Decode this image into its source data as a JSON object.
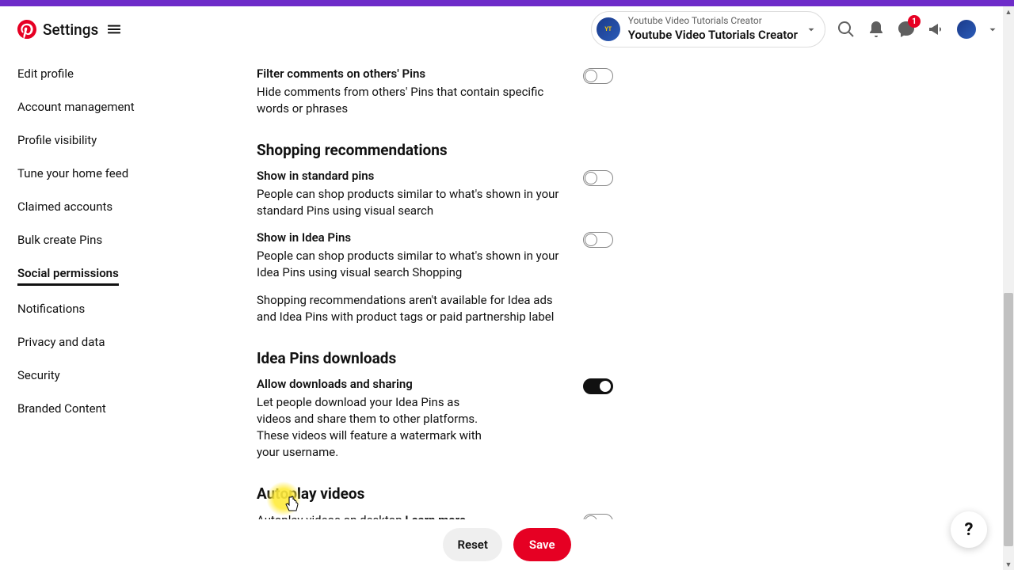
{
  "header": {
    "title": "Settings",
    "account": {
      "line1": "Youtube Video Tutorials Creator",
      "line2": "Youtube Video Tutorials Creator"
    },
    "message_badge": "1"
  },
  "sidebar": {
    "items": [
      {
        "label": "Edit profile"
      },
      {
        "label": "Account management"
      },
      {
        "label": "Profile visibility"
      },
      {
        "label": "Tune your home feed"
      },
      {
        "label": "Claimed accounts"
      },
      {
        "label": "Bulk create Pins"
      },
      {
        "label": "Social permissions",
        "active": true
      },
      {
        "label": "Notifications"
      },
      {
        "label": "Privacy and data"
      },
      {
        "label": "Security"
      },
      {
        "label": "Branded Content"
      }
    ]
  },
  "settings": {
    "filter_comments": {
      "title": "Filter comments on others' Pins",
      "desc": "Hide comments from others' Pins that contain specific words or phrases"
    },
    "shopping_heading": "Shopping recommendations",
    "standard_pins": {
      "title": "Show in standard pins",
      "desc": "People can shop products similar to what's shown in your standard Pins using visual search"
    },
    "idea_pins": {
      "title": "Show in Idea Pins",
      "desc": "People can shop products similar to what's shown in your Idea Pins using visual search Shopping"
    },
    "shopping_note": "Shopping recommendations aren't available for Idea ads and Idea Pins with product tags or paid partnership label",
    "downloads_heading": "Idea Pins downloads",
    "downloads": {
      "title": "Allow downloads and sharing",
      "desc": "Let people download your Idea Pins as videos and share them to other platforms. These videos will feature a watermark with your username."
    },
    "autoplay_heading": "Autoplay videos",
    "autoplay": {
      "desc": "Autoplay videos on desktop ",
      "learn_more": "Learn more"
    }
  },
  "footer": {
    "reset": "Reset",
    "save": "Save"
  },
  "help": "?"
}
